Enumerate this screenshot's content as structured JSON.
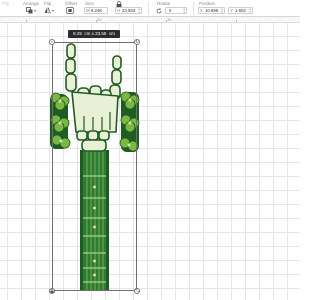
{
  "toolbar": {
    "flip_label": "Flip",
    "arrange_label": "Arrange",
    "flip2_label": "Flip",
    "offset_label": "Offset",
    "size_label": "Size",
    "rotate_label": "Rotate",
    "position_label": "Position",
    "width_axis": "W",
    "width_value": "8.248",
    "height_axis": "H",
    "height_value": "23.553",
    "rotate_value": "0",
    "x_axis": "X",
    "x_value": "10.896",
    "y_axis": "Y",
    "y_value": "1.602"
  },
  "ruler": {
    "marks": [
      "20",
      "30"
    ]
  },
  "canvas": {
    "dimension_tooltip": "8.25  cm x 23.55  cm"
  },
  "icons": {
    "arrange": "arrange-icon",
    "flip": "flip-icon",
    "offset": "offset-icon",
    "lock": "lock-icon",
    "rotate_handle": "rotate-icon",
    "resize_handle": "resize-icon",
    "close_handle": "close-icon",
    "lock_handle": "lock-icon"
  },
  "colors": {
    "dark_green": "#1f5c23",
    "mid_green": "#2e7b32",
    "flower_green": "#7ab842",
    "bone_cream": "#e9f0d5",
    "selection_gray": "#6f6f6f"
  }
}
